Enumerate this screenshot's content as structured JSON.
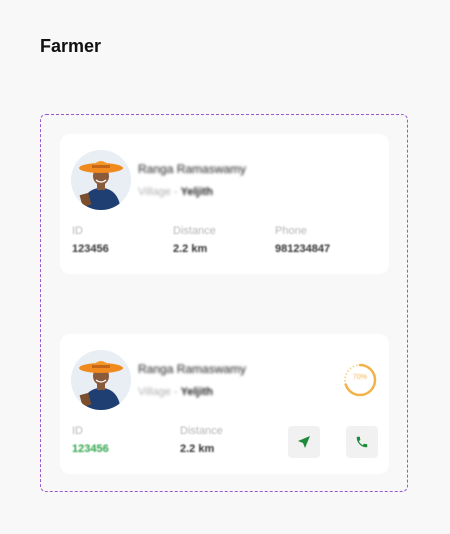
{
  "page": {
    "title": "Farmer"
  },
  "cards": [
    {
      "name": "Ranga Ramaswamy",
      "village_label": "Village - ",
      "village_value": "Yeljith",
      "fields": [
        {
          "label": "ID",
          "value": "123456"
        },
        {
          "label": "Distance",
          "value": "2.2 km"
        },
        {
          "label": "Phone",
          "value": "981234847"
        }
      ]
    },
    {
      "name": "Ranga Ramaswamy",
      "village_label": "Village - ",
      "village_value": "Yeljith",
      "progress": {
        "text": "70%",
        "fraction": 0.7,
        "color": "#f3b24a"
      },
      "fields": [
        {
          "label": "ID",
          "value": "123456",
          "value_color": "#2fa44a"
        },
        {
          "label": "Distance",
          "value": "2.2 km"
        }
      ],
      "actions": [
        {
          "icon": "navigation-arrow-icon"
        },
        {
          "icon": "phone-icon"
        }
      ]
    }
  ],
  "colors": {
    "accent_green": "#1e8a3a",
    "frame_dashed": "#9b59d0"
  }
}
